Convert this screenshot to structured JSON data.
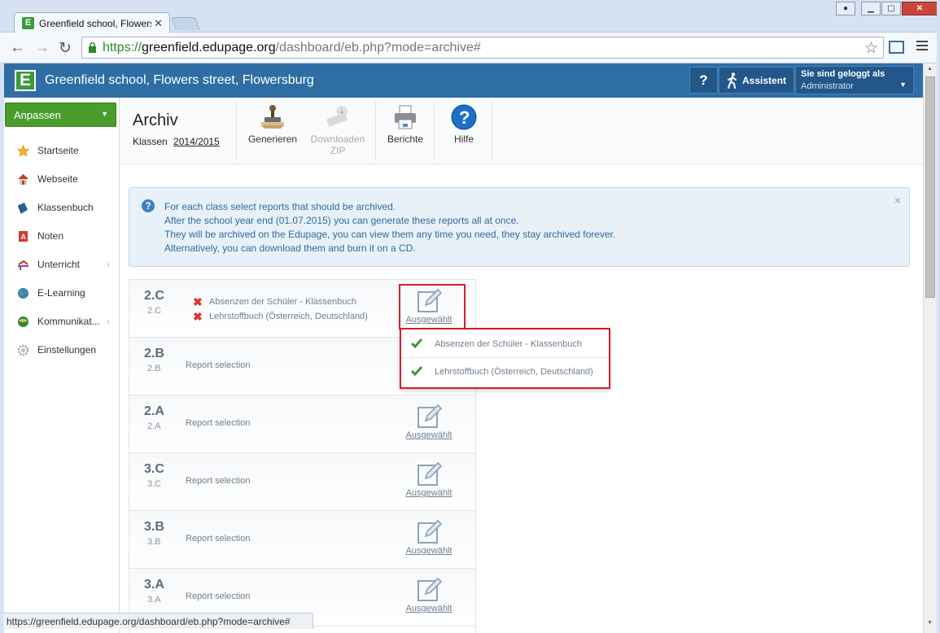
{
  "browser": {
    "tab_title": "Greenfield school, Flowers street, Flowersburg",
    "tab_favicon": "E",
    "url_scheme": "https://",
    "url_host": "greenfield.edupage.org",
    "url_path": "/dashboard/eb.php?mode=archive#",
    "status_url": "https://greenfield.edupage.org/dashboard/eb.php?mode=archive#",
    "icons": [
      "back-icon",
      "forward-icon",
      "reload-icon",
      "lock-icon",
      "star-icon",
      "cast-icon",
      "menu-icon"
    ]
  },
  "header": {
    "logo": "E",
    "school_name": "Greenfield school, Flowers street, Flowersburg",
    "help_label": "?",
    "assistant_label": "Assistent",
    "login_line1": "Sie sind geloggt als",
    "login_line2": "Administrator",
    "brand_color": "#2f6ea5"
  },
  "sidebar": {
    "customize_label": "Anpassen",
    "items": [
      {
        "label": "Startseite",
        "icon": "star-icon",
        "has_submenu": false
      },
      {
        "label": "Webseite",
        "icon": "house-icon",
        "has_submenu": false
      },
      {
        "label": "Klassenbuch",
        "icon": "book-icon",
        "has_submenu": false
      },
      {
        "label": "Noten",
        "icon": "grades-icon",
        "has_submenu": false
      },
      {
        "label": "Unterricht",
        "icon": "teaching-icon",
        "has_submenu": true
      },
      {
        "label": "E-Learning",
        "icon": "globe-icon",
        "has_submenu": false
      },
      {
        "label": "Kommunikat...",
        "icon": "communication-icon",
        "has_submenu": true
      },
      {
        "label": "Einstellungen",
        "icon": "gear-icon",
        "has_submenu": false
      }
    ]
  },
  "page": {
    "title": "Archiv",
    "subtitle_label": "Klassen",
    "school_year": "2014/2015",
    "tools": [
      {
        "label": "Generieren",
        "icon": "stamp-icon",
        "enabled": true
      },
      {
        "label": "Downloaden ZIP",
        "icon": "download-zip-icon",
        "enabled": false
      },
      {
        "label": "Berichte",
        "icon": "printer-icon",
        "enabled": true
      },
      {
        "label": "Hilfe",
        "icon": "help-icon",
        "enabled": true
      }
    ]
  },
  "info": {
    "lines": [
      "For each class select reports that should be archived.",
      "After the school year end (01.07.2015) you can generate these reports all at once.",
      "They will be archived on the Edupage, you can view them any time you need, they stay archived forever.",
      "Alternatively, you can download them and burn it on a CD."
    ],
    "close": "×"
  },
  "classes": {
    "edit_label": "Ausgewählt",
    "rows": [
      {
        "code": "2.C",
        "sub": "2.C",
        "reports": [
          "Absenzen der Schüler - Klassenbuch",
          "Lehrstoffbuch (Österreich, Deutschland)"
        ]
      },
      {
        "code": "2.B",
        "sub": "2.B",
        "report_text": "Report selection"
      },
      {
        "code": "2.A",
        "sub": "2.A",
        "report_text": "Report selection"
      },
      {
        "code": "3.C",
        "sub": "3.C",
        "report_text": "Report selection"
      },
      {
        "code": "3.B",
        "sub": "3.B",
        "report_text": "Report selection"
      },
      {
        "code": "3.A",
        "sub": "3.A",
        "report_text": "Report selection"
      }
    ]
  },
  "popup": {
    "items": [
      {
        "label": "Absenzen der Schüler - Klassenbuch",
        "checked": true
      },
      {
        "label": "Lehrstoffbuch (Österreich, Deutschland)",
        "checked": true
      }
    ],
    "highlight_color": "#d0202a"
  }
}
